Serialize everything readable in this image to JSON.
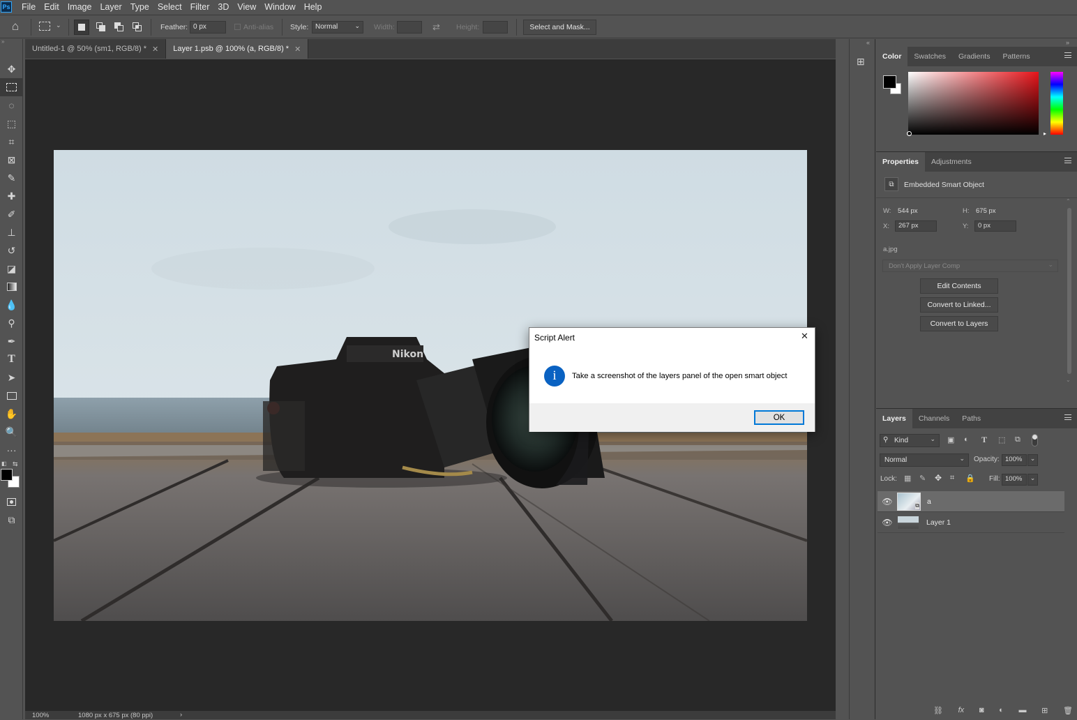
{
  "app": {
    "logo": "Ps"
  },
  "menubar": {
    "items": [
      "File",
      "Edit",
      "Image",
      "Layer",
      "Type",
      "Select",
      "Filter",
      "3D",
      "View",
      "Window",
      "Help"
    ]
  },
  "options": {
    "feather_label": "Feather:",
    "feather_value": "0 px",
    "antialias_label": "Anti-alias",
    "style_label": "Style:",
    "style_value": "Normal",
    "width_label": "Width:",
    "height_label": "Height:",
    "select_mask_label": "Select and Mask..."
  },
  "tabs": [
    {
      "label": "Untitled-1 @ 50% (sm1, RGB/8) *"
    },
    {
      "label": "Layer 1.psb @ 100% (a, RGB/8) *"
    }
  ],
  "status": {
    "zoom": "100%",
    "doc_info": "1080 px x 675 px (80 ppi)"
  },
  "color_panel": {
    "tabs": [
      "Color",
      "Swatches",
      "Gradients",
      "Patterns"
    ],
    "fg": "#000000",
    "bg": "#ffffff",
    "hue": "#ff0000"
  },
  "properties": {
    "tabs": [
      "Properties",
      "Adjustments"
    ],
    "type_label": "Embedded Smart Object",
    "w_label": "W:",
    "w_value": "544 px",
    "h_label": "H:",
    "h_value": "675 px",
    "x_label": "X:",
    "x_value": "267 px",
    "y_label": "Y:",
    "y_value": "0 px",
    "filename": "a.jpg",
    "layer_comp": "Don't Apply Layer Comp",
    "buttons": [
      "Edit Contents",
      "Convert to Linked...",
      "Convert to Layers"
    ]
  },
  "layers_panel": {
    "tabs": [
      "Layers",
      "Channels",
      "Paths"
    ],
    "filter_kind": "Kind",
    "blend_mode": "Normal",
    "opacity_label": "Opacity:",
    "opacity_value": "100%",
    "lock_label": "Lock:",
    "fill_label": "Fill:",
    "fill_value": "100%",
    "layers": [
      {
        "name": "a",
        "selected": true
      },
      {
        "name": "Layer 1",
        "selected": false
      }
    ]
  },
  "dialog": {
    "title": "Script Alert",
    "message": "Take a screenshot of the layers panel of the open smart object",
    "ok_label": "OK",
    "close_glyph": "✕"
  }
}
